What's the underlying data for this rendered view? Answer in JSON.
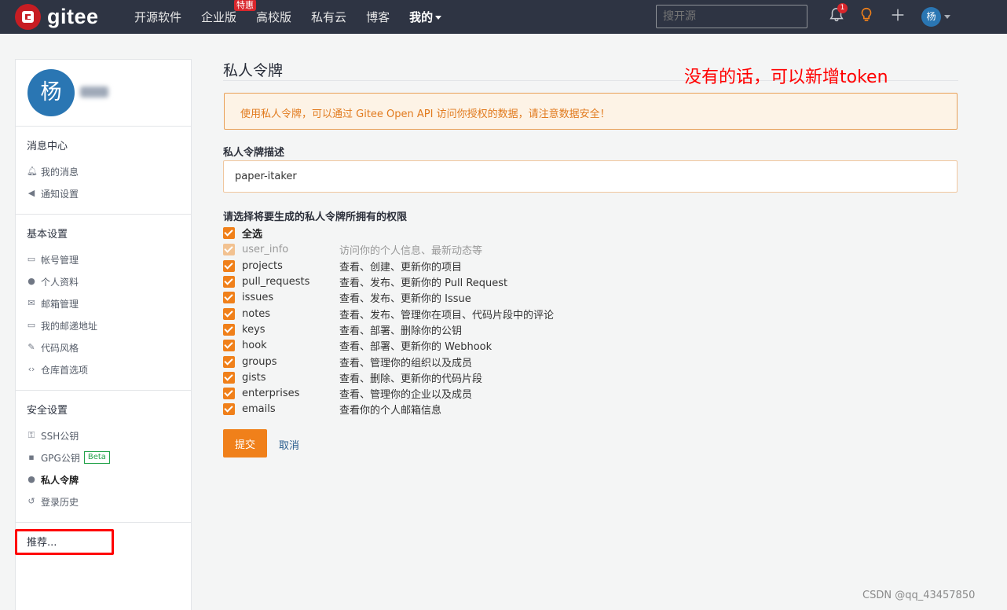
{
  "nav": {
    "logo_text": "gitee",
    "items": [
      "开源软件",
      "企业版",
      "高校版",
      "私有云",
      "博客",
      "我的"
    ],
    "hot_badge": "特惠",
    "search_placeholder": "搜开源",
    "notification_count": "1",
    "avatar_char": "杨"
  },
  "sidebar": {
    "avatar_char": "杨",
    "groups": [
      {
        "title": "消息中心",
        "items": [
          "我的消息",
          "通知设置"
        ]
      },
      {
        "title": "基本设置",
        "items": [
          "帐号管理",
          "个人资料",
          "邮箱管理",
          "我的邮递地址",
          "代码风格",
          "仓库首选项"
        ]
      },
      {
        "title": "安全设置",
        "items": [
          "SSH公钥",
          "GPG公钥",
          "私人令牌",
          "登录历史"
        ]
      },
      {
        "title": "推荐..."
      }
    ],
    "beta_badge": "Beta"
  },
  "main": {
    "page_title": "私人令牌",
    "annotation": "没有的话，可以新增token",
    "warning": "使用私人令牌，可以通过 Gitee Open API 访问你授权的数据，请注意数据安全！",
    "desc_label": "私人令牌描述",
    "desc_value": "paper-itaker",
    "perm_label": "请选择将要生成的私人令牌所拥有的权限",
    "select_all": "全选",
    "permissions": [
      {
        "name": "user_info",
        "desc": "访问你的个人信息、最新动态等"
      },
      {
        "name": "projects",
        "desc": "查看、创建、更新你的项目"
      },
      {
        "name": "pull_requests",
        "desc": "查看、发布、更新你的 Pull Request"
      },
      {
        "name": "issues",
        "desc": "查看、发布、更新你的 Issue"
      },
      {
        "name": "notes",
        "desc": "查看、发布、管理你在项目、代码片段中的评论"
      },
      {
        "name": "keys",
        "desc": "查看、部署、删除你的公钥"
      },
      {
        "name": "hook",
        "desc": "查看、部署、更新你的 Webhook"
      },
      {
        "name": "groups",
        "desc": "查看、管理你的组织以及成员"
      },
      {
        "name": "gists",
        "desc": "查看、删除、更新你的代码片段"
      },
      {
        "name": "enterprises",
        "desc": "查看、管理你的企业以及成员"
      },
      {
        "name": "emails",
        "desc": "查看你的个人邮箱信息"
      }
    ],
    "submit": "提交",
    "cancel": "取消"
  },
  "watermark": "CSDN @qq_43457850",
  "colors": {
    "accent": "#f0801a",
    "topbar": "#2e3443",
    "annotation": "#ff0000"
  }
}
